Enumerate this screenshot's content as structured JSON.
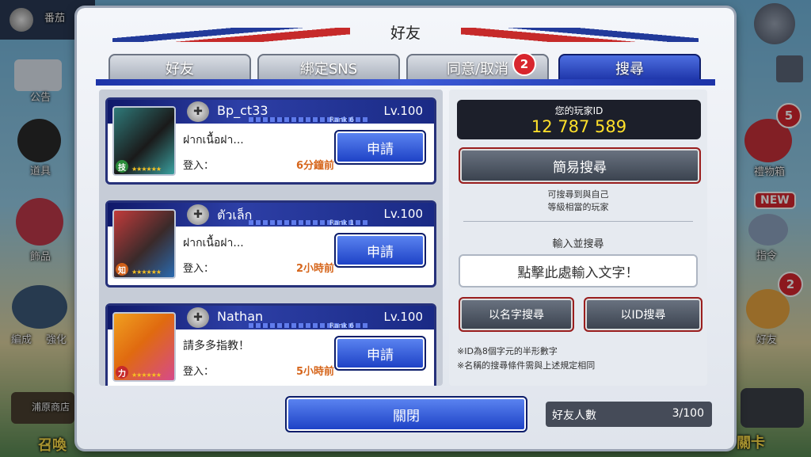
{
  "background": {
    "player_name": "番茄",
    "left_menu": [
      {
        "label": "公告"
      },
      {
        "label": "道具"
      },
      {
        "label": "飾品"
      },
      {
        "label": "編成"
      },
      {
        "label": "強化"
      },
      {
        "label": "浦原商店"
      },
      {
        "label": "召喚"
      }
    ],
    "right_menu": [
      {
        "label": "禮物箱",
        "badge": "5"
      },
      {
        "label": "指令",
        "badge": "NEW"
      },
      {
        "label": "好友",
        "badge": "2"
      },
      {
        "label": "關卡"
      }
    ]
  },
  "modal": {
    "title": "好友",
    "tabs": [
      {
        "label": "好友"
      },
      {
        "label": "綁定SNS"
      },
      {
        "label": "同意/取消",
        "badge": "2"
      },
      {
        "label": "搜尋",
        "active": true
      }
    ]
  },
  "friends": [
    {
      "name": "Bp_ct33",
      "level": "Lv.100",
      "rank": "Rank  6",
      "message": "ฝากเนื้อฝา...",
      "login_label": "登入：",
      "login_time": "6分鐘前",
      "button": "申請",
      "attr": "技"
    },
    {
      "name": "ตัวเล็ก",
      "level": "Lv.100",
      "rank": "Rank  1",
      "message": "ฝากเนื้อฝา...",
      "login_label": "登入：",
      "login_time": "2小時前",
      "button": "申請",
      "attr": "知"
    },
    {
      "name": "Nathan",
      "level": "Lv.100",
      "rank": "Rank  6",
      "message": "請多多指教！",
      "login_label": "登入：",
      "login_time": "5小時前",
      "button": "申請",
      "attr": "力"
    }
  ],
  "search": {
    "id_label": "您的玩家ID",
    "id_value": "12 787 589",
    "simple_search": "簡易搜尋",
    "simple_hint_1": "可搜尋到與自己",
    "simple_hint_2": "等級相當的玩家",
    "input_label": "輸入並搜尋",
    "input_placeholder": "點擊此處輸入文字！",
    "by_name": "以名字搜尋",
    "by_id": "以ID搜尋",
    "note_1": "※ID為8個字元的半形數字",
    "note_2": "※名稱的搜尋條件需與上述規定相同"
  },
  "footer": {
    "close": "關閉",
    "friend_count_label": "好友人數",
    "friend_count": "3/100"
  },
  "colors": {
    "accent_blue": "#1b3fc4",
    "badge_red": "#d8262e",
    "time_orange": "#d6661c",
    "id_yellow": "#ffe02a"
  }
}
